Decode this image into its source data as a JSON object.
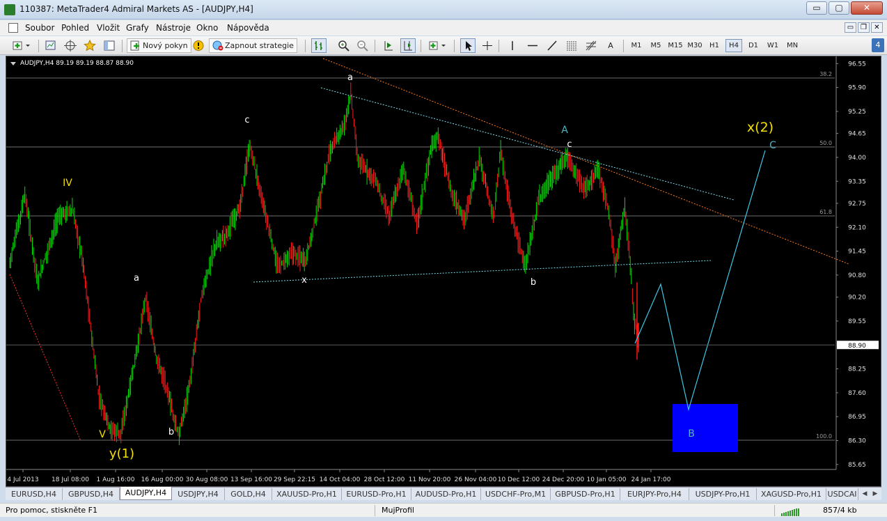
{
  "window": {
    "title": "110387: MetaTrader4 Admiral Markets AS - [AUDJPY,H4]",
    "minimize": "▭",
    "maximize": "▢",
    "close": "✕"
  },
  "menu": {
    "items": [
      "Soubor",
      "Pohled",
      "Vložit",
      "Grafy",
      "Nástroje",
      "Okno",
      "Nápověda"
    ]
  },
  "mdi": {
    "minimize": "▭",
    "restore": "❐",
    "close": "✕"
  },
  "toolbar": {
    "new_order": "Nový pokyn",
    "autotrading": "Zapnout strategie",
    "text_tool": "A",
    "timeframes": [
      "M1",
      "M5",
      "M15",
      "M30",
      "H1",
      "H4",
      "D1",
      "W1",
      "MN"
    ],
    "active_timeframe": "H4",
    "notification_count": "4"
  },
  "chart": {
    "header": "AUDJPY,H4  89.19 89.19 88.87 88.90",
    "current_price": "88.90",
    "price_labels": [
      "96.55",
      "95.90",
      "95.25",
      "94.65",
      "94.00",
      "93.35",
      "92.75",
      "92.10",
      "91.45",
      "90.80",
      "90.20",
      "89.55",
      "88.90",
      "88.25",
      "87.60",
      "86.95",
      "86.30",
      "85.65"
    ],
    "fib_levels": [
      "38.2",
      "50.0",
      "61.8",
      "100.0"
    ],
    "time_labels": [
      "4 Jul 2013",
      "18 Jul 08:00",
      "1 Aug 16:00",
      "16 Aug 00:00",
      "30 Aug 08:00",
      "13 Sep 16:00",
      "29 Sep 22:15",
      "14 Oct 04:00",
      "28 Oct 12:00",
      "11 Nov 20:00",
      "26 Nov 04:00",
      "10 Dec 12:00",
      "24 Dec 20:00",
      "10 Jan 05:00",
      "24 Jan 17:00"
    ],
    "wave_labels": {
      "iv": "IV",
      "v": "V",
      "y1": "y(1)",
      "a1": "a",
      "b1": "b",
      "c1": "c",
      "x1": "x",
      "a2": "a",
      "b2": "b",
      "c2": "c",
      "big_a": "A",
      "big_b": "B",
      "big_c": "C",
      "x2": "x(2)"
    },
    "colors": {
      "background": "#000000",
      "bull": "#00e000",
      "bear": "#ff1a1a",
      "grid": "#6e6e6e",
      "trend_cyan": "#7fe0f0",
      "trend_orange": "#ff7a1a",
      "projection": "#3fc8e8",
      "target_box": "#0000ff",
      "wave_white": "#ffffff",
      "wave_yellow": "#f5e000",
      "wave_teal": "#4fb4c4"
    }
  },
  "tabs": {
    "items": [
      "EURUSD,H4",
      "GBPUSD,H4",
      "AUDJPY,H4",
      "USDJPY,H4",
      "GOLD,H4",
      "XAUUSD-Pro,H1",
      "EURUSD-Pro,H1",
      "AUDUSD-Pro,H1",
      "USDCHF-Pro,M1",
      "GBPUSD-Pro,H1",
      "EURJPY-Pro,H4",
      "USDJPY-Pro,H1",
      "XAGUSD-Pro,H1",
      "USDCAI"
    ],
    "active": "AUDJPY,H4",
    "prev": "◀",
    "next": "▶"
  },
  "status": {
    "help": "Pro pomoc, stiskněte F1",
    "profile": "MujProfil",
    "connection": "857/4 kb"
  }
}
